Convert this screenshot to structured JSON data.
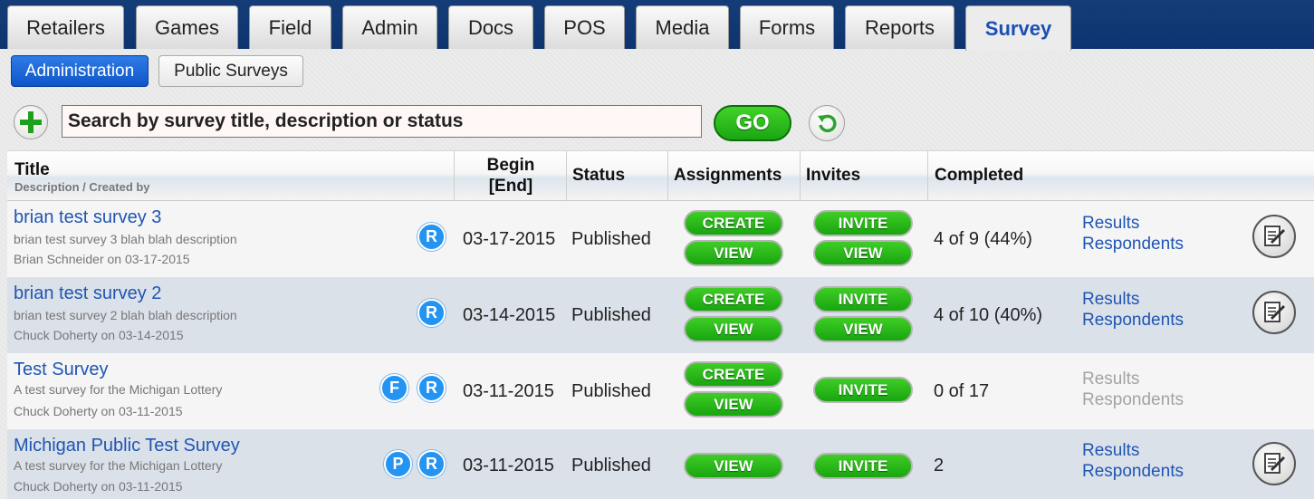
{
  "tabs": [
    "Retailers",
    "Games",
    "Field",
    "Admin",
    "Docs",
    "POS",
    "Media",
    "Forms",
    "Reports",
    "Survey"
  ],
  "subtabs": [
    "Administration",
    "Public Surveys"
  ],
  "search": {
    "placeholder": "Search by survey title, description or status",
    "go_label": "GO"
  },
  "table": {
    "headers": {
      "title": "Title",
      "title_sub": "Description / Created by",
      "begin": "Begin",
      "end": "[End]",
      "status": "Status",
      "assignments": "Assignments",
      "invites": "Invites",
      "completed": "Completed"
    },
    "buttons": {
      "create": "CREATE",
      "view": "VIEW",
      "invite": "INVITE"
    },
    "links": {
      "results": "Results",
      "respondents": "Respondents"
    },
    "rows": [
      {
        "title": "brian test survey 3",
        "description": "brian test survey 3 blah blah description",
        "created_by": "Brian Schneider on 03-17-2015",
        "badges": [
          "R"
        ],
        "begin": "03-17-2015",
        "status": "Published",
        "completed": "4 of 9 (44%)"
      },
      {
        "title": "brian test survey 2",
        "description": "brian test survey 2 blah blah description",
        "created_by": "Chuck Doherty on 03-14-2015",
        "badges": [
          "R"
        ],
        "begin": "03-14-2015",
        "status": "Published",
        "completed": "4 of 10 (40%)"
      },
      {
        "title": "Test Survey",
        "description": "A test survey for the Michigan Lottery",
        "created_by": "Chuck Doherty on 03-11-2015",
        "badges": [
          "F",
          "R"
        ],
        "begin": "03-11-2015",
        "status": "Published",
        "completed": "0 of 17"
      },
      {
        "title": "Michigan Public Test Survey",
        "description": "A test survey for the Michigan Lottery",
        "created_by": "Chuck Doherty on 03-11-2015",
        "badges": [
          "P",
          "R"
        ],
        "begin": "03-11-2015",
        "status": "Published",
        "completed": "2"
      }
    ]
  },
  "colors": {
    "accent": "#1f55b3",
    "green_button": "#1aa612",
    "header_bar": "#0d3470",
    "badge": "#2494f2"
  },
  "icons": {
    "add": "plus-circle-icon",
    "reset": "refresh-arrow-icon",
    "edit": "edit-document-icon"
  }
}
